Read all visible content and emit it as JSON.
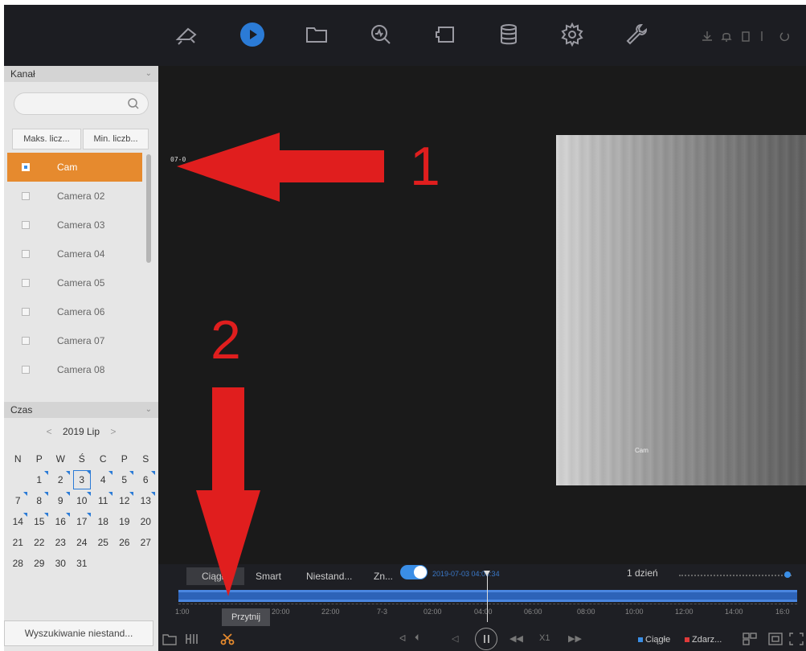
{
  "nav": {
    "icons": [
      "live-view-icon",
      "playback-icon",
      "file-icon",
      "smart-search-icon",
      "backup-icon",
      "storage-icon",
      "settings-icon",
      "maintenance-icon"
    ],
    "active_color": "#2b7bd6"
  },
  "channel_panel": {
    "header": "Kanał",
    "main_stream_btn": "Maks. licz...",
    "sub_stream_btn": "Min. liczb...",
    "cameras": [
      "Cam",
      "Camera 02",
      "Camera 03",
      "Camera 04",
      "Camera 05",
      "Camera 06",
      "Camera 07",
      "Camera 08"
    ],
    "selected": "Cam",
    "selected_color": "#e68a2e"
  },
  "time_panel": {
    "header": "Czas",
    "month_title": "2019 Lip",
    "weekdays": [
      "N",
      "P",
      "W",
      "Ś",
      "C",
      "P",
      "S"
    ],
    "today": "3",
    "days": [
      "",
      "1",
      "2",
      "3",
      "4",
      "5",
      "6",
      "7",
      "8",
      "9",
      "10",
      "11",
      "12",
      "13",
      "14",
      "15",
      "16",
      "17",
      "18",
      "19",
      "20",
      "21",
      "22",
      "23",
      "24",
      "25",
      "26",
      "27",
      "28",
      "29",
      "30",
      "31"
    ],
    "custom_search": "Wyszukiwanie niestand..."
  },
  "video": {
    "overlay_timestamp": "07-0",
    "camera_overlay": "Cam"
  },
  "timeline": {
    "tabs": [
      "Ciągłe",
      "Smart",
      "Niestand...",
      "Zn..."
    ],
    "datetime": "2019-07-03 04:06:34",
    "range": "1 dzień",
    "ticks": [
      "1:00",
      "20:00",
      "22:00",
      "7-3",
      "02:00",
      "04:00",
      "06:00",
      "08:00",
      "10:00",
      "12:00",
      "14:00",
      "16:0"
    ],
    "tooltip": "Przytnij",
    "speed": "X1",
    "legend": [
      {
        "label": "Ciągłe",
        "color": "#3a8ee6"
      },
      {
        "label": "Zdarz...",
        "color": "#e03a3a"
      }
    ]
  },
  "annotations": {
    "label_1": "1",
    "label_2": "2",
    "color": "#e01e1e"
  }
}
